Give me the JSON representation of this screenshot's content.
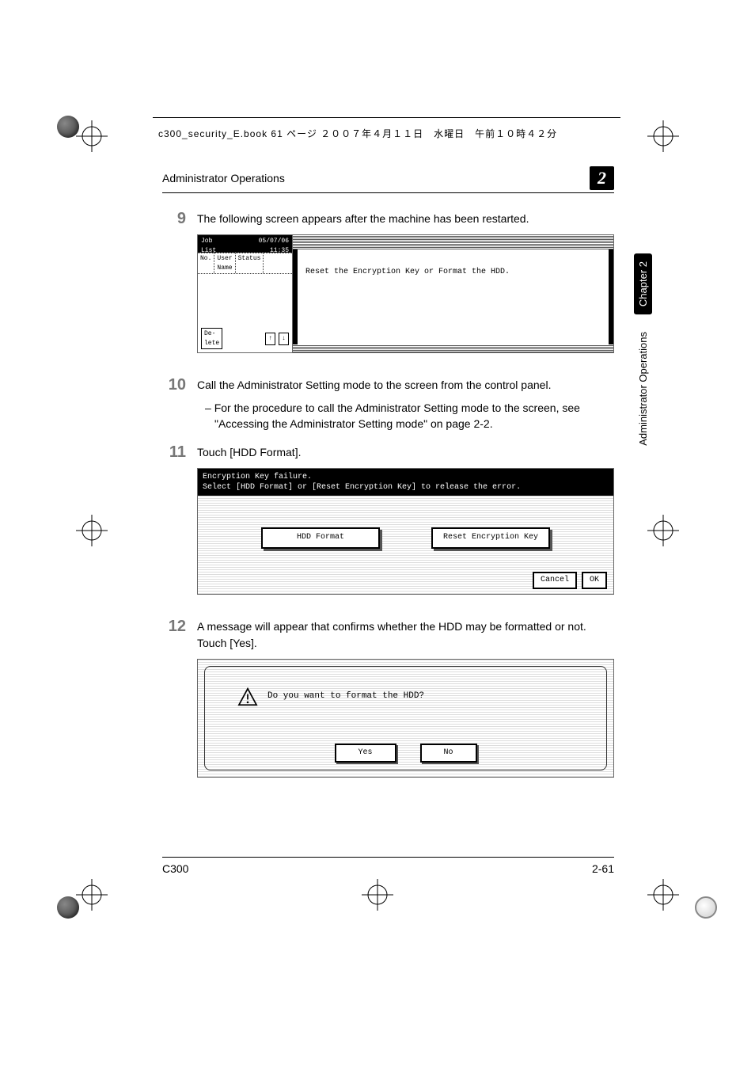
{
  "crop_header": "c300_security_E.book  61 ページ  ２００７年４月１１日　水曜日　午前１０時４２分",
  "page_header": {
    "section": "Administrator Operations",
    "chapter_num": "2"
  },
  "side_tabs": {
    "chapter": "Chapter 2",
    "section": "Administrator Operations"
  },
  "steps": {
    "s9": {
      "num": "9",
      "text": "The following screen appears after the machine has been restarted."
    },
    "s10": {
      "num": "10",
      "text": "Call the Administrator Setting mode to the screen from the control panel.",
      "sub": "For the procedure to call the Administrator Setting mode to the screen, see \"Accessing the Administrator Setting mode\" on page 2-2."
    },
    "s11": {
      "num": "11",
      "text": "Touch [HDD Format]."
    },
    "s12": {
      "num": "12",
      "text": "A message will appear that confirms whether the HDD may be formatted or not.",
      "text2": "Touch [Yes]."
    }
  },
  "shot1": {
    "job_list_label": "Job\nList",
    "datetime": "05/07/06\n11:35",
    "col_no": "No.",
    "col_user": "User\nName",
    "col_status": "Status",
    "delete_btn": "De-\nlete",
    "arrow_up": "↑",
    "arrow_down": "↓",
    "message": "Reset the Encryption Key or Format the HDD."
  },
  "shot2": {
    "title_line1": "Encryption Key failure.",
    "title_line2": "Select [HDD Format] or [Reset Encryption Key] to release the error.",
    "btn_left": "HDD Format",
    "btn_right": "Reset Encryption Key",
    "cancel": "Cancel",
    "ok": "OK"
  },
  "shot3": {
    "message": "Do you want to format the HDD?",
    "yes": "Yes",
    "no": "No"
  },
  "footer": {
    "model": "C300",
    "page": "2-61"
  }
}
